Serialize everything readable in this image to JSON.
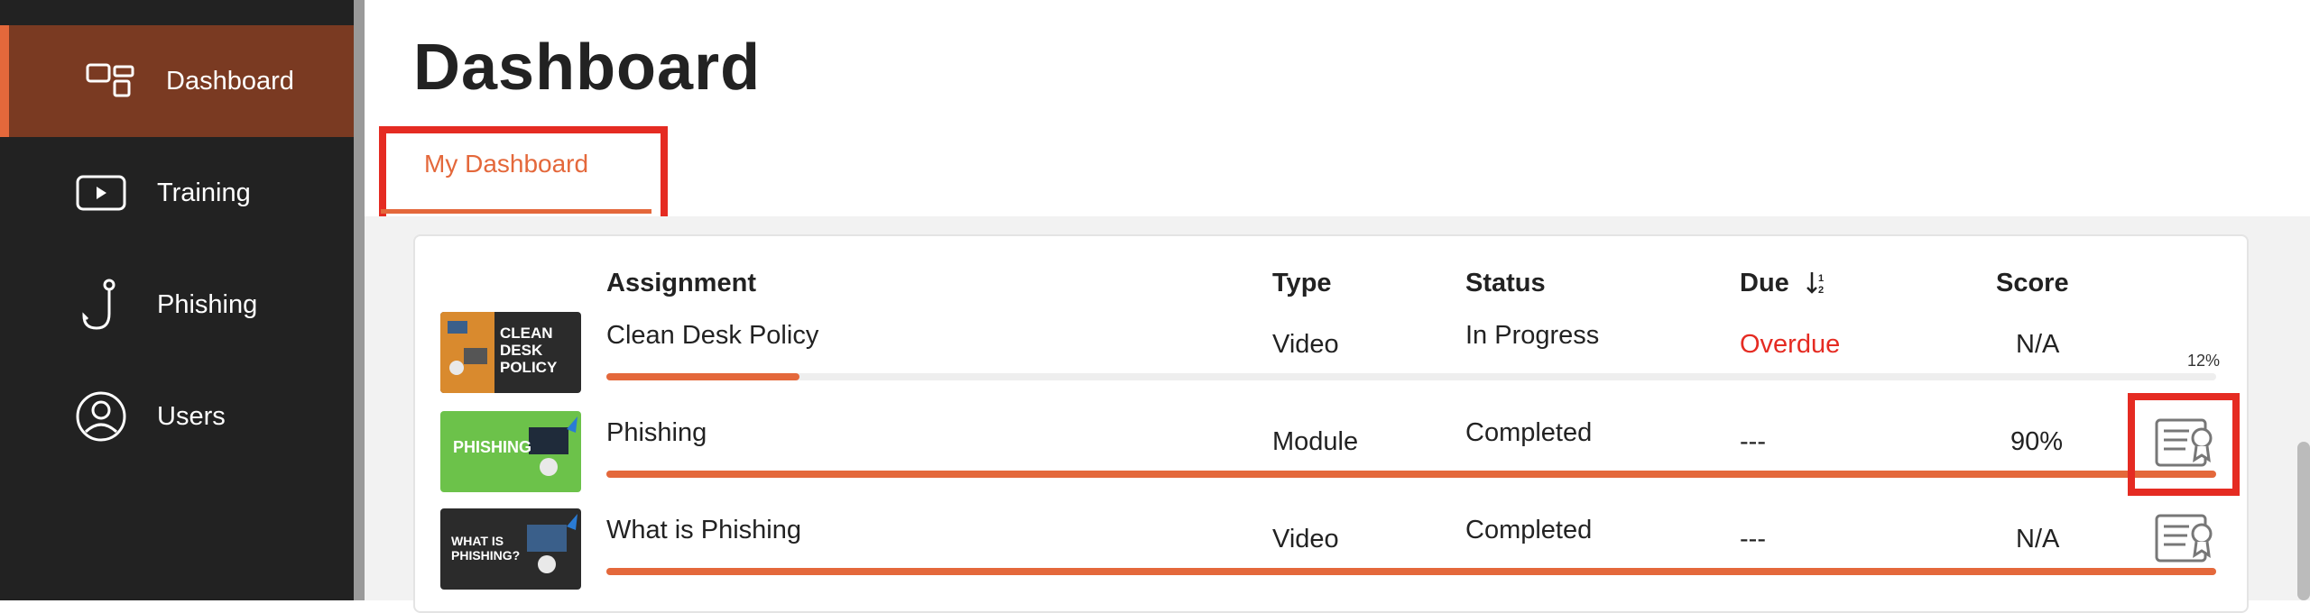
{
  "sidebar": {
    "items": [
      {
        "label": "Dashboard",
        "icon": "dashboard-icon",
        "active": true
      },
      {
        "label": "Training",
        "icon": "play-icon",
        "active": false
      },
      {
        "label": "Phishing",
        "icon": "hook-icon",
        "active": false
      },
      {
        "label": "Users",
        "icon": "user-icon",
        "active": false
      }
    ]
  },
  "page": {
    "title": "Dashboard"
  },
  "tabs": [
    {
      "label": "My Dashboard",
      "active": true
    }
  ],
  "table": {
    "headers": {
      "assignment": "Assignment",
      "type": "Type",
      "status": "Status",
      "due": "Due",
      "score": "Score",
      "sort_icon": "sort-icon"
    },
    "rows": [
      {
        "assignment": "Clean Desk Policy",
        "type": "Video",
        "status": "In Progress",
        "due": "Overdue",
        "score": "N/A",
        "progress": 0.12,
        "progress_label": "12%",
        "thumb_text": "CLEAN DESK POLICY",
        "thumb_color": "#2b2b2b"
      },
      {
        "assignment": "Phishing",
        "type": "Module",
        "status": "Completed",
        "due": "---",
        "score": "90%",
        "progress": 1.0,
        "progress_label": "",
        "thumb_text": "PHISHING",
        "thumb_color": "#6cc24a",
        "certificate_icon": "certificate-icon"
      },
      {
        "assignment": "What is Phishing",
        "type": "Video",
        "status": "Completed",
        "due": "---",
        "score": "N/A",
        "progress": 1.0,
        "progress_label": "",
        "thumb_text": "WHAT IS PHISHING?",
        "thumb_color": "#2b2b2b",
        "certificate_icon": "certificate-icon"
      }
    ]
  },
  "colors": {
    "accent": "#e4683b",
    "sidebar_bg": "#222222",
    "active_bg": "#7a3a22",
    "highlight": "#e52b22",
    "overdue": "#e52b22"
  }
}
